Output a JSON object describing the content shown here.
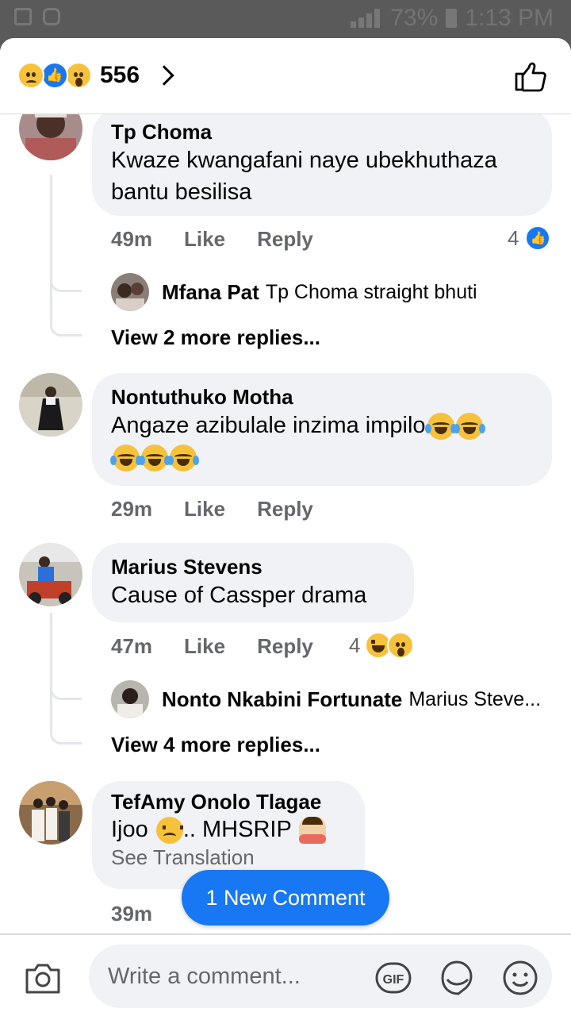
{
  "status": {
    "battery": "73%",
    "time": "1:13 PM"
  },
  "header": {
    "reaction_count": "556",
    "reactions": [
      "sad",
      "like",
      "wow"
    ]
  },
  "comments": [
    {
      "author": "Tp Choma",
      "text": "Kwaze kwangafani naye ubekhuthaza bantu besilisa",
      "time": "49m",
      "like": "Like",
      "reply": "Reply",
      "reaction_count": "4",
      "reactions": [
        "like"
      ],
      "reply_preview": {
        "author": "Mfana Pat",
        "text": "Tp Choma straight bhuti"
      },
      "view_more": "View 2 more replies..."
    },
    {
      "author": "Nontuthuko Motha",
      "text": "Angaze azibulale inzima impilo",
      "emojis": [
        "crying-laughing",
        "crying-laughing",
        "crying-laughing",
        "crying-laughing",
        "crying-laughing"
      ],
      "time": "29m",
      "like": "Like",
      "reply": "Reply"
    },
    {
      "author": "Marius Stevens",
      "text": "Cause of Cassper drama",
      "time": "47m",
      "like": "Like",
      "reply": "Reply",
      "reaction_count": "4",
      "reactions": [
        "haha",
        "wow"
      ],
      "reply_preview": {
        "author": "Nonto Nkabini Fortunate",
        "text": "Marius Steve..."
      },
      "view_more": "View 4 more replies..."
    },
    {
      "author": "TefAmy Onolo Tlagae",
      "text_a": "Ijoo",
      "text_b": ".. MHSRIP",
      "see_translation": "See Translation",
      "time": "39m"
    }
  ],
  "new_comment_label": "1 New Comment",
  "composer": {
    "placeholder": "Write a comment..."
  }
}
